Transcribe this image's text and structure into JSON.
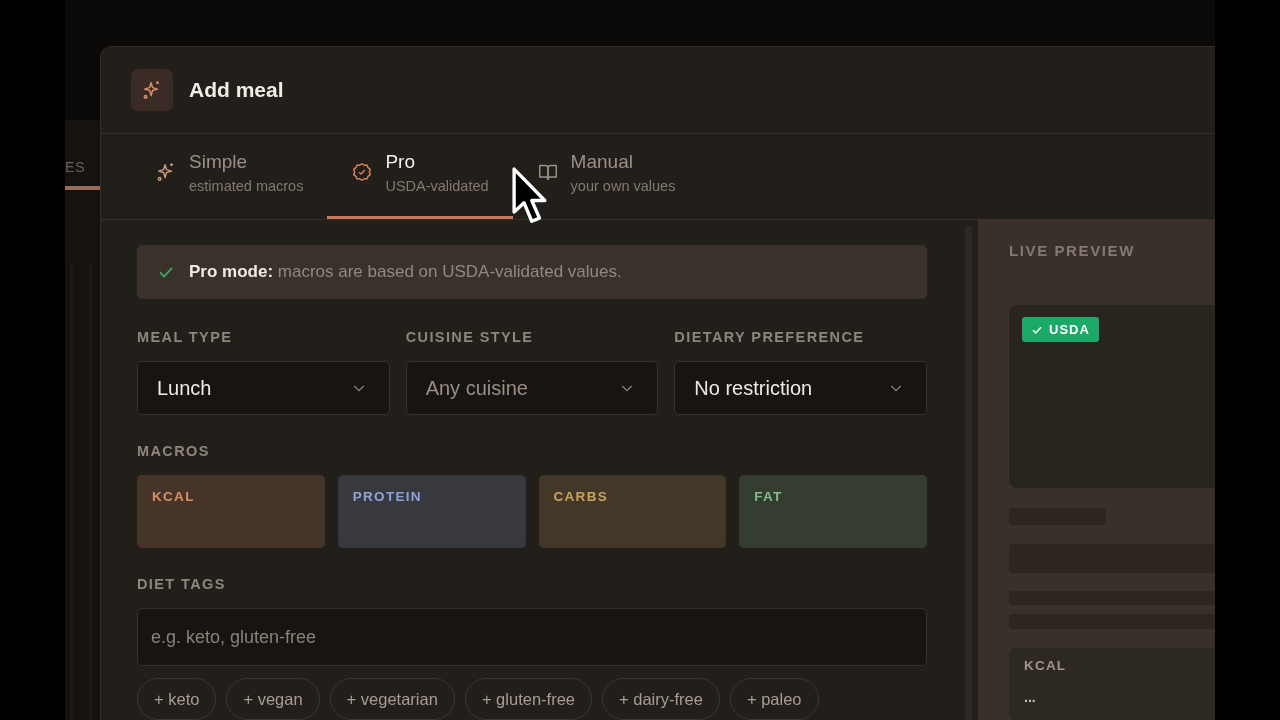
{
  "background": {
    "tab_fragment": "ES"
  },
  "dialog": {
    "title": "Add meal"
  },
  "tabs": [
    {
      "label": "Simple",
      "subtitle": "estimated macros",
      "selected": false
    },
    {
      "label": "Pro",
      "subtitle": "USDA-validated",
      "selected": true
    },
    {
      "label": "Manual",
      "subtitle": "your own values",
      "selected": false
    }
  ],
  "notice": {
    "text": "**Pro mode:** macros are based on USDA-validated values."
  },
  "selects": [
    {
      "label": "MEAL TYPE",
      "value": "Lunch",
      "is_placeholder": false
    },
    {
      "label": "CUISINE STYLE",
      "value": "Any cuisine",
      "is_placeholder": true
    },
    {
      "label": "DIETARY PREFERENCE",
      "value": "No restriction",
      "is_placeholder": false
    }
  ],
  "macros": {
    "label": "MACROS",
    "items": [
      {
        "label": "KCAL",
        "color": "#d9906a"
      },
      {
        "label": "PROTEIN",
        "color": "#8fa3d9"
      },
      {
        "label": "CARBS",
        "color": "#c9a25e"
      },
      {
        "label": "FAT",
        "color": "#7fbf8f"
      }
    ]
  },
  "diet_tags": {
    "label": "DIET TAGS",
    "placeholder": "e.g. keto, gluten-free",
    "suggestions": [
      "+ keto",
      "+ vegan",
      "+ vegetarian",
      "+ gluten-free",
      "+ dairy-free",
      "+ paleo"
    ]
  },
  "preview": {
    "label": "LIVE PREVIEW",
    "badge": "USDA",
    "stat_label": "KCAL",
    "stat_value": "..."
  }
}
